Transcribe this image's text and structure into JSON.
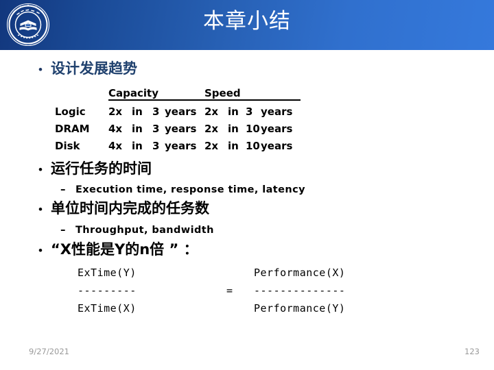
{
  "header": {
    "title": "本章小结",
    "gradient_from": "#12377d",
    "gradient_to": "#3579dc",
    "logo_name": "university-seal-logo"
  },
  "bullets": [
    {
      "marker": "•",
      "text": "设计发展趋势",
      "color": "#20416e"
    },
    {
      "marker": "•",
      "text": "运行任务的时间",
      "color": "#000000",
      "sub": {
        "marker": "–",
        "text": "Execution time, response time, latency"
      }
    },
    {
      "marker": "•",
      "text": "单位时间内完成的任务数",
      "color": "#000000",
      "sub": {
        "marker": "–",
        "text": "Throughput, bandwidth"
      }
    },
    {
      "marker": "•",
      "text": "“X性能是Y的n倍 ” ：",
      "color": "#000000"
    }
  ],
  "trend_table": {
    "headers": [
      "",
      "Capacity",
      "Speed"
    ],
    "rows": [
      {
        "name": "Logic",
        "capacity": {
          "factor": "2x",
          "in": "in",
          "n": "3",
          "unit": "years"
        },
        "speed": {
          "factor": "2x",
          "in": "in",
          "n": "3",
          "unit": "years"
        }
      },
      {
        "name": "DRAM",
        "capacity": {
          "factor": "4x",
          "in": "in",
          "n": "3",
          "unit": "years"
        },
        "speed": {
          "factor": "2x",
          "in": "in",
          "n": "10",
          "unit": "years"
        }
      },
      {
        "name": "Disk",
        "capacity": {
          "factor": "4x",
          "in": "in",
          "n": "3",
          "unit": "years"
        },
        "speed": {
          "factor": "2x",
          "in": "in",
          "n": "10",
          "unit": "years"
        }
      }
    ]
  },
  "formula": {
    "left_numerator": "ExTime(Y)",
    "left_bar": "---------",
    "left_denominator": "ExTime(X)",
    "equals": "=",
    "right_numerator": "Performance(X)",
    "right_bar": "--------------",
    "right_denominator": "Performance(Y)"
  },
  "footer": {
    "date": "9/27/2021",
    "page": "123"
  }
}
